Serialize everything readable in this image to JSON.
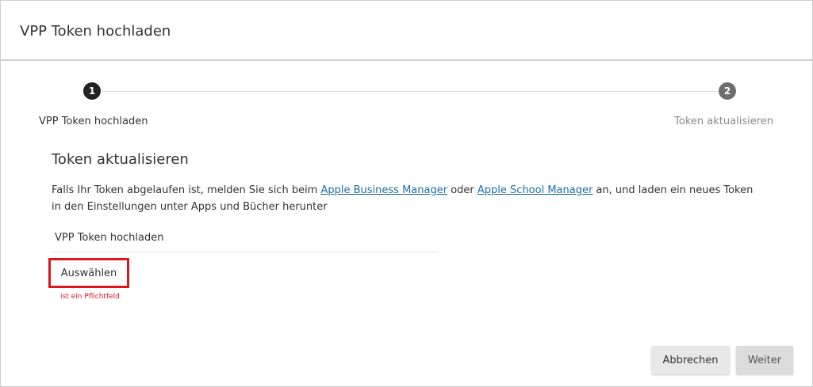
{
  "header": {
    "title": "VPP Token hochladen"
  },
  "stepper": {
    "steps": [
      {
        "number": "1",
        "label": "VPP Token hochladen"
      },
      {
        "number": "2",
        "label": "Token aktualisieren"
      }
    ]
  },
  "section": {
    "title": "Token aktualisieren",
    "desc_before_link1": "Falls Ihr Token abgelaufen ist, melden Sie sich beim ",
    "link1": "Apple Business Manager",
    "desc_between_links": " oder ",
    "link2": "Apple School Manager",
    "desc_after_link2": " an, und laden ein neues Token in den Einstellungen unter Apps und Bücher herunter"
  },
  "upload": {
    "field_label": "VPP Token hochladen",
    "choose_label": "Auswählen",
    "required_message": "ist ein Pflichtfeld"
  },
  "footer": {
    "cancel_label": "Abbrechen",
    "next_label": "Weiter"
  },
  "colors": {
    "error": "#e0141e",
    "link": "#1a6fa8",
    "step_active": "#222222",
    "step_inactive": "#6e6e6e"
  }
}
